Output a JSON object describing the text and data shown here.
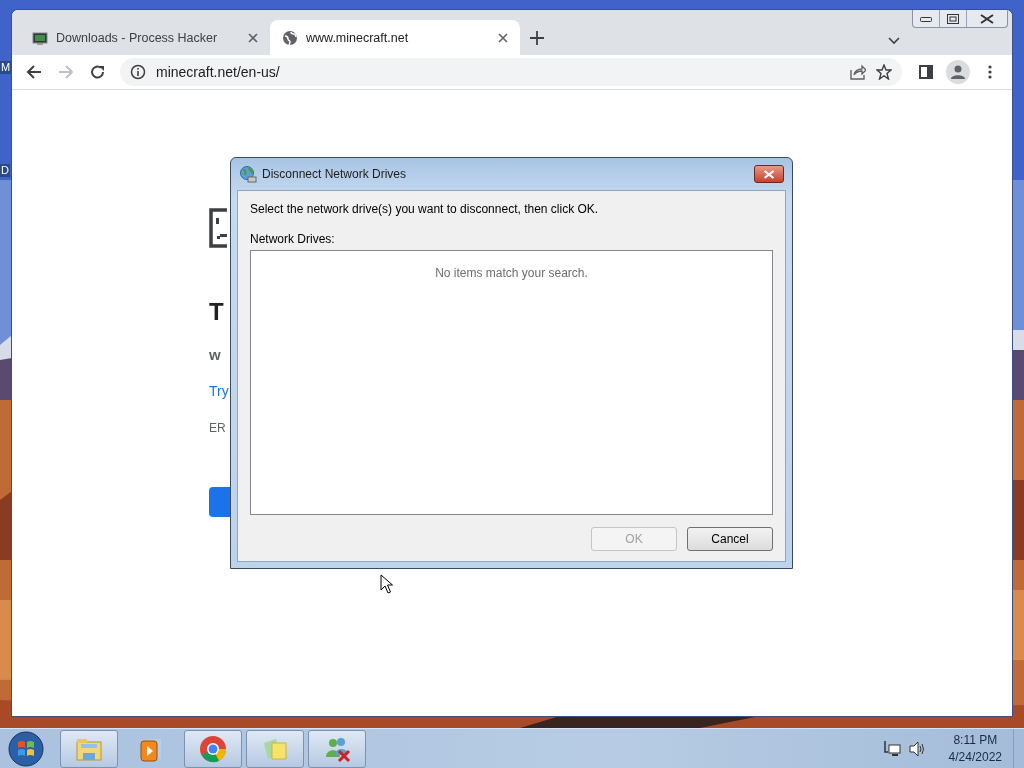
{
  "desktop": {
    "icon_labels": [
      "M",
      "D"
    ]
  },
  "browser": {
    "tabs": [
      {
        "title": "Downloads - Process Hacker",
        "kind": "app",
        "selected": false
      },
      {
        "title": "www.minecraft.net",
        "kind": "web",
        "selected": true
      }
    ],
    "address": "minecraft.net/en-us/",
    "page": {
      "heading": "T",
      "subtitle": "w",
      "link": "Try",
      "error_code": "ER"
    }
  },
  "dialog": {
    "title": "Disconnect Network Drives",
    "instruction": "Select the network drive(s) you want to disconnect, then click OK.",
    "list_label": "Network Drives:",
    "empty_message": "No items match your search.",
    "buttons": [
      {
        "label": "OK",
        "disabled": true
      },
      {
        "label": "Cancel",
        "disabled": false
      }
    ]
  },
  "taskbar": {
    "apps": [
      {
        "kind": "explorer",
        "running": true
      },
      {
        "kind": "media",
        "running": false
      },
      {
        "kind": "chrome",
        "running": true
      },
      {
        "kind": "notes",
        "running": true
      },
      {
        "kind": "network",
        "running": true
      }
    ],
    "clock": {
      "time": "8:11 PM",
      "date": "4/24/2022"
    }
  }
}
